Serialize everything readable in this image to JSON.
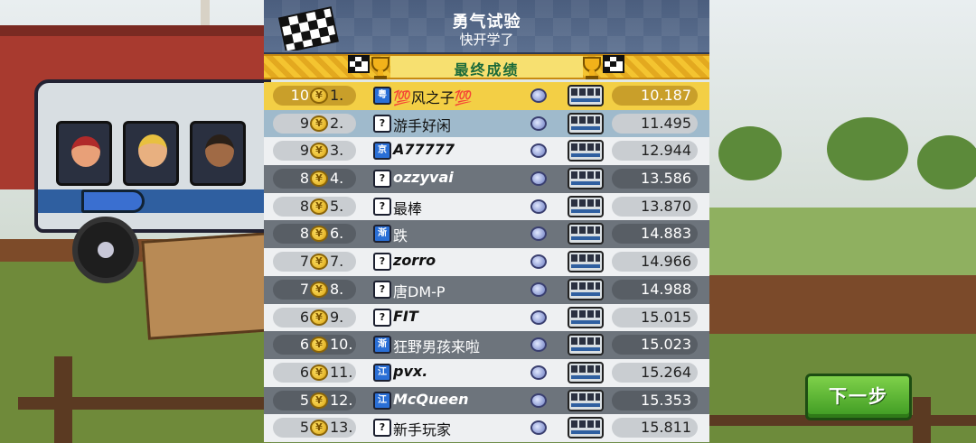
{
  "header": {
    "title": "勇气试验",
    "subtitle": "快开学了"
  },
  "banner": {
    "label": "最终成绩"
  },
  "results": [
    {
      "points": "10",
      "rank": "1.",
      "badge": "粤",
      "name": "💯风之子💯",
      "time": "10.187",
      "style": "gold"
    },
    {
      "points": "9",
      "rank": "2.",
      "badge": "?",
      "name": "游手好闲",
      "time": "11.495",
      "style": "bluish"
    },
    {
      "points": "9",
      "rank": "3.",
      "badge": "京",
      "name": "A77777",
      "time": "12.944",
      "style": "light"
    },
    {
      "points": "8",
      "rank": "4.",
      "badge": "?",
      "name": "ozzyvai",
      "time": "13.586",
      "style": "dark"
    },
    {
      "points": "8",
      "rank": "5.",
      "badge": "?",
      "name": "最棒",
      "time": "13.870",
      "style": "light"
    },
    {
      "points": "8",
      "rank": "6.",
      "badge": "渐",
      "name": "跌",
      "time": "14.883",
      "style": "dark"
    },
    {
      "points": "7",
      "rank": "7.",
      "badge": "?",
      "name": "zorro",
      "time": "14.966",
      "style": "light"
    },
    {
      "points": "7",
      "rank": "8.",
      "badge": "?",
      "name": "唐DM-P",
      "time": "14.988",
      "style": "dark"
    },
    {
      "points": "6",
      "rank": "9.",
      "badge": "?",
      "name": "FIT",
      "time": "15.015",
      "style": "light"
    },
    {
      "points": "6",
      "rank": "10.",
      "badge": "渐",
      "name": "狂野男孩来啦",
      "time": "15.023",
      "style": "dark"
    },
    {
      "points": "6",
      "rank": "11.",
      "badge": "江",
      "name": "pvx.",
      "time": "15.264",
      "style": "light"
    },
    {
      "points": "5",
      "rank": "12.",
      "badge": "江",
      "name": "McQueen",
      "time": "15.353",
      "style": "dark"
    },
    {
      "points": "5",
      "rank": "13.",
      "badge": "?",
      "name": "新手玩家",
      "time": "15.811",
      "style": "light"
    }
  ],
  "icons": {
    "coin": "coin-icon",
    "gem": "gem-icon",
    "vehicle": "bus-vehicle-icon",
    "flag": "checkered-flag-icon",
    "trophy": "trophy-icon"
  },
  "next_button": {
    "label": "下一步"
  },
  "colors": {
    "first_place_row": "#f3cf45",
    "player_row": "#9fbacc",
    "next_button": "#4fb02c",
    "banner_text": "#1b6a3a"
  }
}
